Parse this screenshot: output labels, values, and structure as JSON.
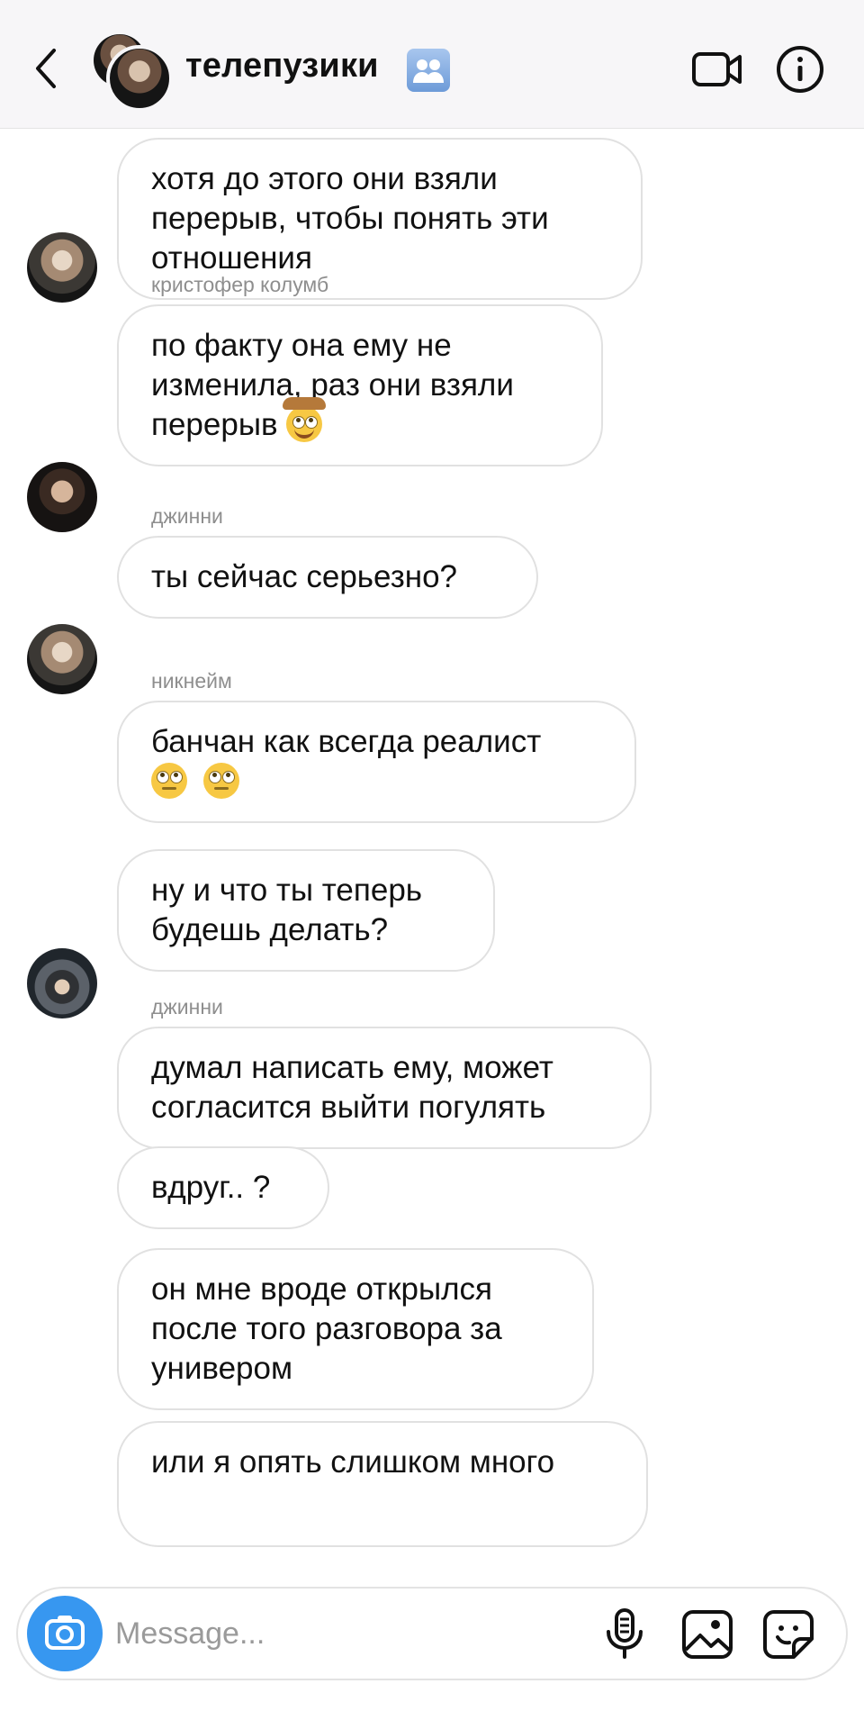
{
  "header": {
    "title": "телепузики",
    "icons": {
      "back": "chevron-left-icon",
      "video": "video-camera-icon",
      "info": "info-icon",
      "badge": "group-emoji-icon"
    }
  },
  "messages": [
    {
      "sender": "",
      "lines": "хотя до этого они взяли перерыв, чтобы понять эти отношения",
      "avatar": "blonde"
    },
    {
      "sender": "кристофер колумб",
      "lines": "по факту она ему не изменила, раз они взяли перерыв",
      "emoji": "cowboy-face-emoji",
      "avatar": "dark"
    },
    {
      "sender": "джинни",
      "lines": "ты сейчас серьезно?",
      "avatar": "blonde"
    },
    {
      "sender": "никнейм",
      "lines": "банчан как всегда реалист",
      "emoji": "eye-roll-emoji x2"
    },
    {
      "sender": "",
      "lines": "ну и что ты теперь будешь делать?",
      "avatar": "hat"
    },
    {
      "sender": "джинни",
      "lines": "думал написать ему, может согласится выйти погулять"
    },
    {
      "sender": "",
      "lines": "вдруг.. ?"
    },
    {
      "sender": "",
      "lines": "он мне вроде открылся после того разговора за универом"
    },
    {
      "sender": "",
      "lines": "или я опять слишком много"
    }
  ],
  "composer": {
    "placeholder": "Message...",
    "icons": {
      "camera": "camera-icon",
      "mic": "microphone-icon",
      "gallery": "gallery-icon",
      "sticker": "sticker-icon"
    }
  },
  "colors": {
    "accent": "#3797f0",
    "header_bg": "#f7f6f8",
    "bubble_border": "#e1e1e1",
    "sender_gray": "#8e8e8e"
  }
}
